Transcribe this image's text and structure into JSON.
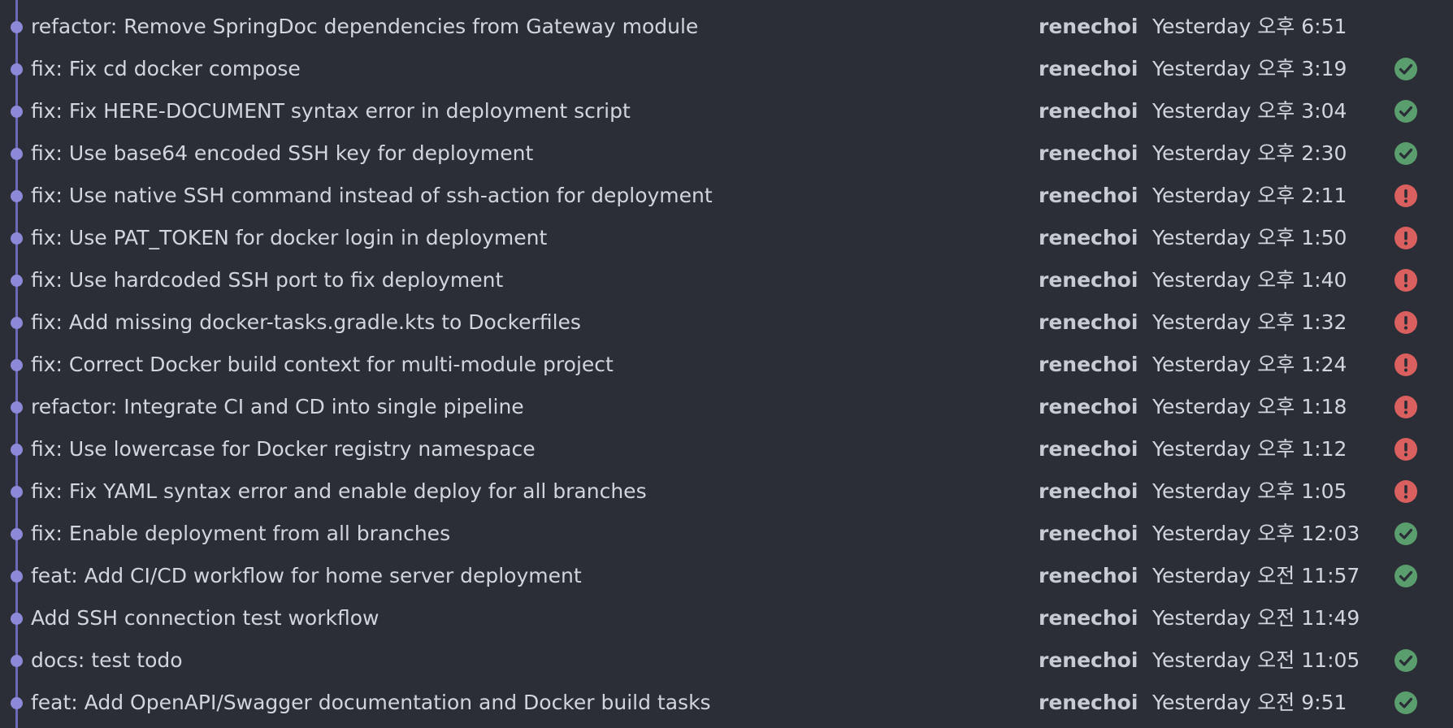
{
  "colors": {
    "background": "#2b2d37",
    "graph": "#6c69b8",
    "success": "#5b9e6e",
    "failure": "#d9605f"
  },
  "commits": [
    {
      "message": "refactor: Remove SpringDoc dependencies from Gateway module",
      "author": "renechoi",
      "time": "Yesterday 오후 6:51",
      "status": "none"
    },
    {
      "message": "fix: Fix cd docker compose",
      "author": "renechoi",
      "time": "Yesterday 오후 3:19",
      "status": "success"
    },
    {
      "message": "fix: Fix HERE-DOCUMENT syntax error in deployment script",
      "author": "renechoi",
      "time": "Yesterday 오후 3:04",
      "status": "success"
    },
    {
      "message": "fix: Use base64 encoded SSH key for deployment",
      "author": "renechoi",
      "time": "Yesterday 오후 2:30",
      "status": "success"
    },
    {
      "message": "fix: Use native SSH command instead of ssh-action for deployment",
      "author": "renechoi",
      "time": "Yesterday 오후 2:11",
      "status": "failure"
    },
    {
      "message": "fix: Use PAT_TOKEN for docker login in deployment",
      "author": "renechoi",
      "time": "Yesterday 오후 1:50",
      "status": "failure"
    },
    {
      "message": "fix: Use hardcoded SSH port to fix deployment",
      "author": "renechoi",
      "time": "Yesterday 오후 1:40",
      "status": "failure"
    },
    {
      "message": "fix: Add missing docker-tasks.gradle.kts to Dockerfiles",
      "author": "renechoi",
      "time": "Yesterday 오후 1:32",
      "status": "failure"
    },
    {
      "message": "fix: Correct Docker build context for multi-module project",
      "author": "renechoi",
      "time": "Yesterday 오후 1:24",
      "status": "failure"
    },
    {
      "message": "refactor: Integrate CI and CD into single pipeline",
      "author": "renechoi",
      "time": "Yesterday 오후 1:18",
      "status": "failure"
    },
    {
      "message": "fix: Use lowercase for Docker registry namespace",
      "author": "renechoi",
      "time": "Yesterday 오후 1:12",
      "status": "failure"
    },
    {
      "message": "fix: Fix YAML syntax error and enable deploy for all branches",
      "author": "renechoi",
      "time": "Yesterday 오후 1:05",
      "status": "failure"
    },
    {
      "message": "fix: Enable deployment from all branches",
      "author": "renechoi",
      "time": "Yesterday 오후 12:03",
      "status": "success"
    },
    {
      "message": "feat: Add CI/CD workflow for home server deployment",
      "author": "renechoi",
      "time": "Yesterday 오전 11:57",
      "status": "success"
    },
    {
      "message": "Add SSH connection test workflow",
      "author": "renechoi",
      "time": "Yesterday 오전 11:49",
      "status": "none"
    },
    {
      "message": "docs: test todo",
      "author": "renechoi",
      "time": "Yesterday 오전 11:05",
      "status": "success"
    },
    {
      "message": "feat: Add OpenAPI/Swagger documentation and Docker build tasks",
      "author": "renechoi",
      "time": "Yesterday 오전 9:51",
      "status": "success"
    }
  ]
}
